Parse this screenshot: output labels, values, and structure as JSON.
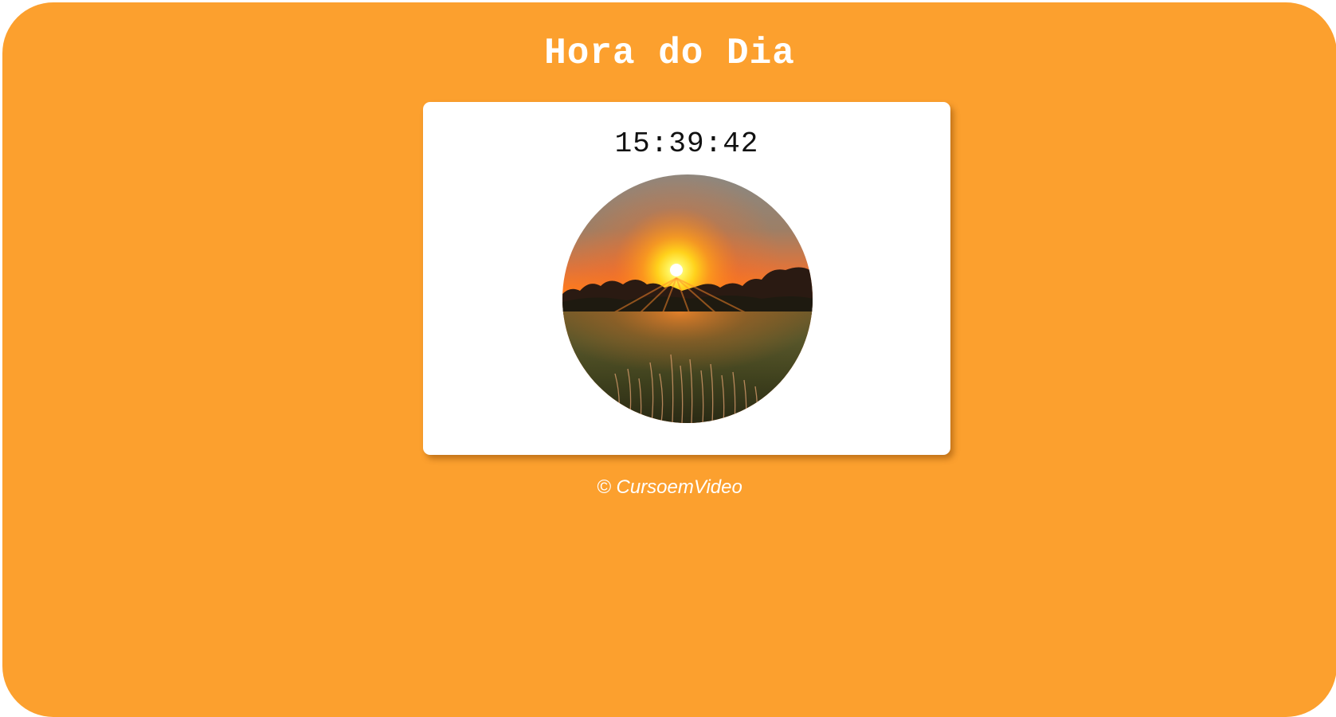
{
  "page": {
    "title": "Hora do Dia",
    "background_color": "#FCA02E"
  },
  "clock": {
    "time": "15:39:42",
    "image_subject": "sunset over field"
  },
  "footer": {
    "text": "© CursoemVideo"
  }
}
